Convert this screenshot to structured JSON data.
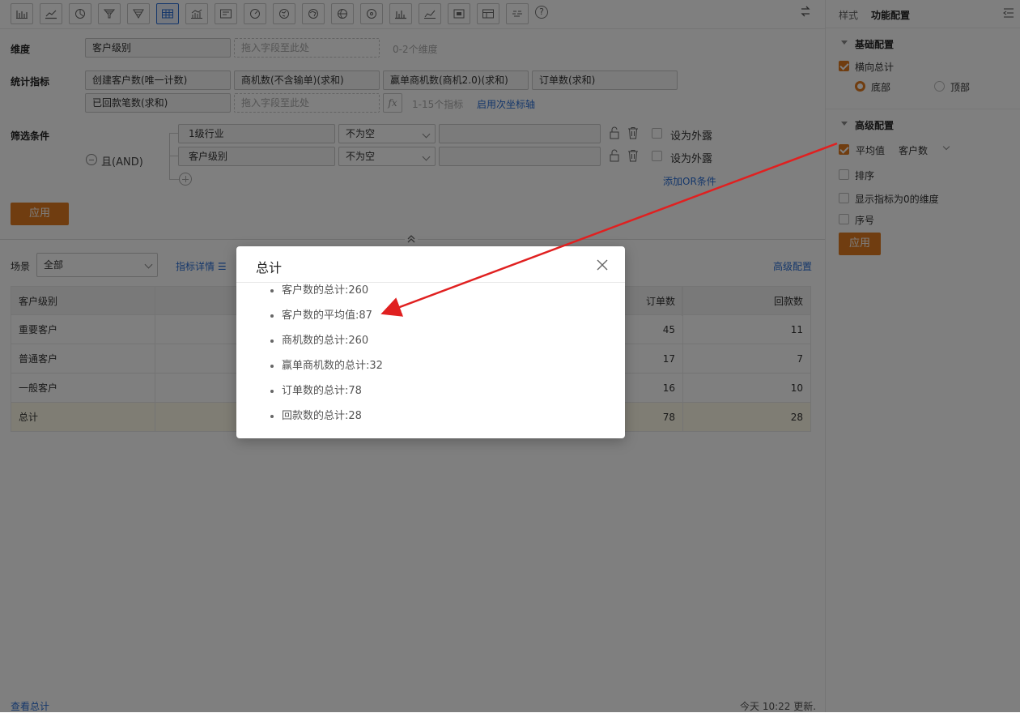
{
  "toolbar": {
    "icons": [
      "bar-chart-icon",
      "line-chart-icon",
      "pie-chart-icon",
      "funnel-icon",
      "funnel-alt-icon",
      "table-icon",
      "combo-chart-icon",
      "card-icon",
      "gauge-icon",
      "map-icon",
      "map-china-icon",
      "world-map-icon",
      "globe-map-icon",
      "column-chart-icon",
      "area-chart-icon",
      "image-chart-icon",
      "detail-table-icon",
      "word-cloud-icon"
    ],
    "active_index": 5,
    "help_label": "?"
  },
  "dimension": {
    "label": "维度",
    "value": "客户级别",
    "drop_placeholder": "拖入字段至此处",
    "hint": "0-2个维度"
  },
  "metrics": {
    "label": "统计指标",
    "items": [
      "创建客户数(唯一计数)",
      "商机数(不含输单)(求和)",
      "赢单商机数(商机2.0)(求和)",
      "订单数(求和)",
      "已回款笔数(求和)"
    ],
    "drop_placeholder": "拖入字段至此处",
    "fx_label": "fx",
    "hint": "1-15个指标",
    "secondary_axis_link": "启用次坐标轴"
  },
  "filters": {
    "label": "筛选条件",
    "logic": "且(AND)",
    "rows": [
      {
        "field": "1级行业",
        "op": "不为空",
        "expose": "设为外露"
      },
      {
        "field": "客户级别",
        "op": "不为空",
        "expose": "设为外露"
      }
    ],
    "add_or": "添加OR条件",
    "apply": "应用"
  },
  "scene": {
    "label": "场景",
    "value": "全部",
    "metric_detail": "指标详情",
    "advanced": "高级配置"
  },
  "table": {
    "headers": [
      "客户级别",
      "订单数",
      "回款数"
    ],
    "rows": [
      [
        "重要客户",
        "45",
        "11"
      ],
      [
        "普通客户",
        "17",
        "7"
      ],
      [
        "一般客户",
        "16",
        "10"
      ],
      [
        "总计",
        "78",
        "28"
      ]
    ]
  },
  "footer": {
    "view_total": "查看总计",
    "updated": "今天 10:22 更新."
  },
  "sidebar": {
    "tabs": [
      "样式",
      "功能配置"
    ],
    "active_tab": 1,
    "basic": {
      "title": "基础配置",
      "horizontal_total": "横向总计",
      "positions": [
        "底部",
        "顶部"
      ],
      "selected": 0
    },
    "advanced": {
      "title": "高级配置",
      "avg_label": "平均值",
      "avg_field": "客户数",
      "sort": "排序",
      "show_zero": "显示指标为0的维度",
      "seq": "序号",
      "apply": "应用"
    }
  },
  "dialog": {
    "title": "总计",
    "items": [
      "客户数的总计:260",
      "客户数的平均值:87",
      "商机数的总计:260",
      "赢单商机数的总计:32",
      "订单数的总计:78",
      "回款数的总计:28"
    ]
  },
  "colors": {
    "accent": "#e07b20",
    "link": "#2b6fd6",
    "arrow": "#e02020"
  }
}
